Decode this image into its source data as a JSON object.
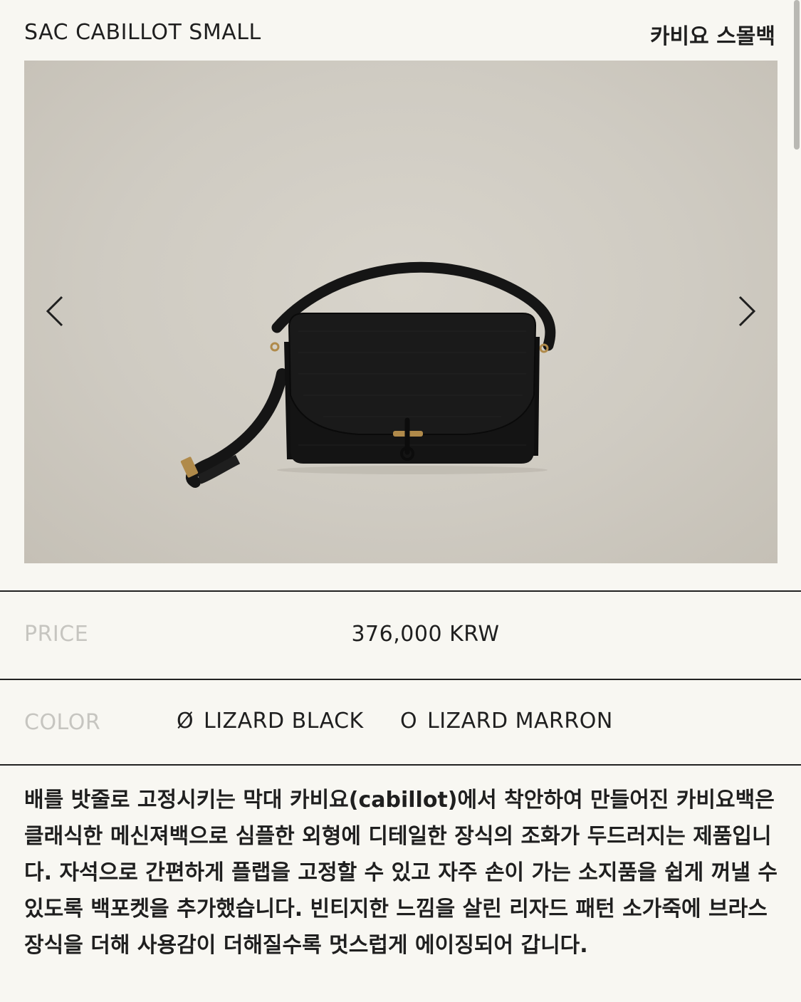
{
  "header": {
    "title_en": "SAC CABILLOT SMALL",
    "title_ko": "카비요 스몰백"
  },
  "gallery": {
    "prev_icon": "chevron-left-icon",
    "next_icon": "chevron-right-icon"
  },
  "price": {
    "label": "PRICE",
    "value": "376,000 KRW"
  },
  "color": {
    "label": "COLOR",
    "options": [
      {
        "symbol": "Ø",
        "name": "LIZARD BLACK",
        "selected": true
      },
      {
        "symbol": "O",
        "name": "LIZARD MARRON",
        "selected": false
      }
    ]
  },
  "description": {
    "text": "배를 밧줄로 고정시키는 막대 카비요(cabillot)에서 착안하여 만들어진 카비요백은 클래식한 메신져백으로 심플한 외형에 디테일한 장식의 조화가 두드러지는 제품입니다. 자석으로 간편하게 플랩을 고정할 수 있고 자주 손이 가는 소지품을 쉽게 꺼낼 수 있도록 백포켓을 추가했습니다. 빈티지한 느낌을 살린 리자드 패턴 소가죽에 브라스 장식을 더해 사용감이 더해질수록 멋스럽게 에이징되어 갑니다."
  },
  "colors": {
    "background": "#f8f7f2",
    "text": "#1f1f1f",
    "muted_label": "#c6c5c0",
    "rule": "#222222",
    "photo_backdrop": "#cfcbc2",
    "bag": "#141414",
    "brass": "#b08a4a"
  }
}
